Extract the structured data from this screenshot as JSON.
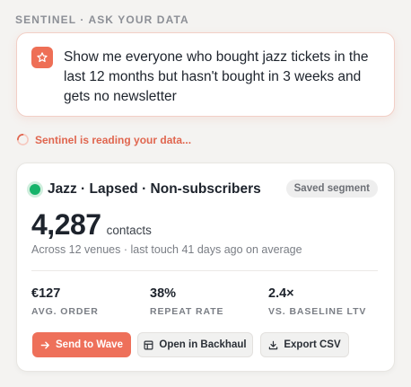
{
  "header": {
    "title": "SENTINEL · ASK YOUR DATA"
  },
  "query": {
    "icon": "star-icon",
    "text": "Show me everyone who bought jazz tickets in the last 12 months but hasn't bought in 3 weeks and gets no newsletter"
  },
  "status": {
    "text": "Sentinel is reading your data..."
  },
  "segment": {
    "title": "Jazz · Lapsed · Non-subscribers",
    "badge": "Saved segment",
    "count": "4,287",
    "count_unit": "contacts",
    "subtitle": "Across 12 venues · last touch 41 days ago on average",
    "metrics": [
      {
        "value": "€127",
        "label": "AVG. ORDER"
      },
      {
        "value": "38%",
        "label": "REPEAT RATE"
      },
      {
        "value": "2.4×",
        "label": "VS. BASELINE LTV"
      }
    ],
    "actions": {
      "send": "Send to Wave",
      "backhaul": "Open in Backhaul",
      "export": "Export CSV"
    }
  },
  "colors": {
    "accent": "#ee6f56",
    "live": "#16b36a"
  }
}
